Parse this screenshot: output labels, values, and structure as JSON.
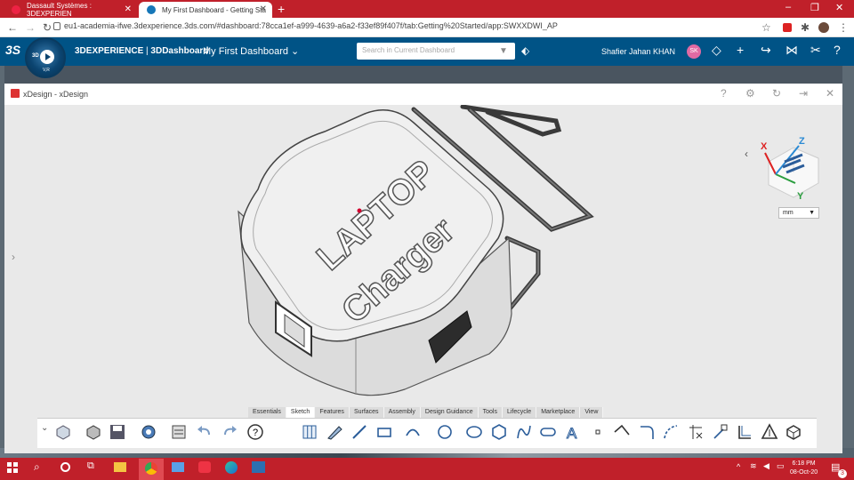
{
  "browser": {
    "tabs": [
      {
        "title": "Dassault Systèmes : 3DEXPERIEN",
        "active": false
      },
      {
        "title": "My First Dashboard - Getting Sta",
        "active": true
      }
    ],
    "new_tab": "+",
    "url": "eu1-academia-ifwe.3dexperience.3ds.com/#dashboard:78cca1ef-a999-4639-a6a2-f33ef89f407f/tab:Getting%20Started/app:SWXXDWI_AP"
  },
  "header": {
    "logo": "3S",
    "compass_label": "3D",
    "compass_sub": "V,R",
    "brand_bold": "3DEXPERIENCE",
    "brand_app": "3DDashboard",
    "dashboard_name": "My First Dashboard",
    "search_placeholder": "Search in Current Dashboard",
    "user_name": "Shafier Jahan KHAN",
    "user_initials": "SK"
  },
  "widget": {
    "title": "xDesign - xDesign"
  },
  "model": {
    "text_line1": "LAPTOP",
    "text_line2": "Charger"
  },
  "viewcube": {
    "x_label": "X",
    "y_label": "Y",
    "z_label": "Z"
  },
  "units": {
    "selected": "mm"
  },
  "ribbon": {
    "tabs": [
      "Essentials",
      "Sketch",
      "Features",
      "Surfaces",
      "Assembly",
      "Design Guidance",
      "Tools",
      "Lifecycle",
      "Marketplace",
      "View"
    ],
    "active_tab": "Sketch"
  },
  "taskbar": {
    "time": "6:18 PM",
    "date": "08-Oct-20",
    "notification_count": "3"
  },
  "colors": {
    "browser_red": "#c0202a",
    "header_blue": "#005386",
    "avatar_pink": "#e06aa3"
  }
}
